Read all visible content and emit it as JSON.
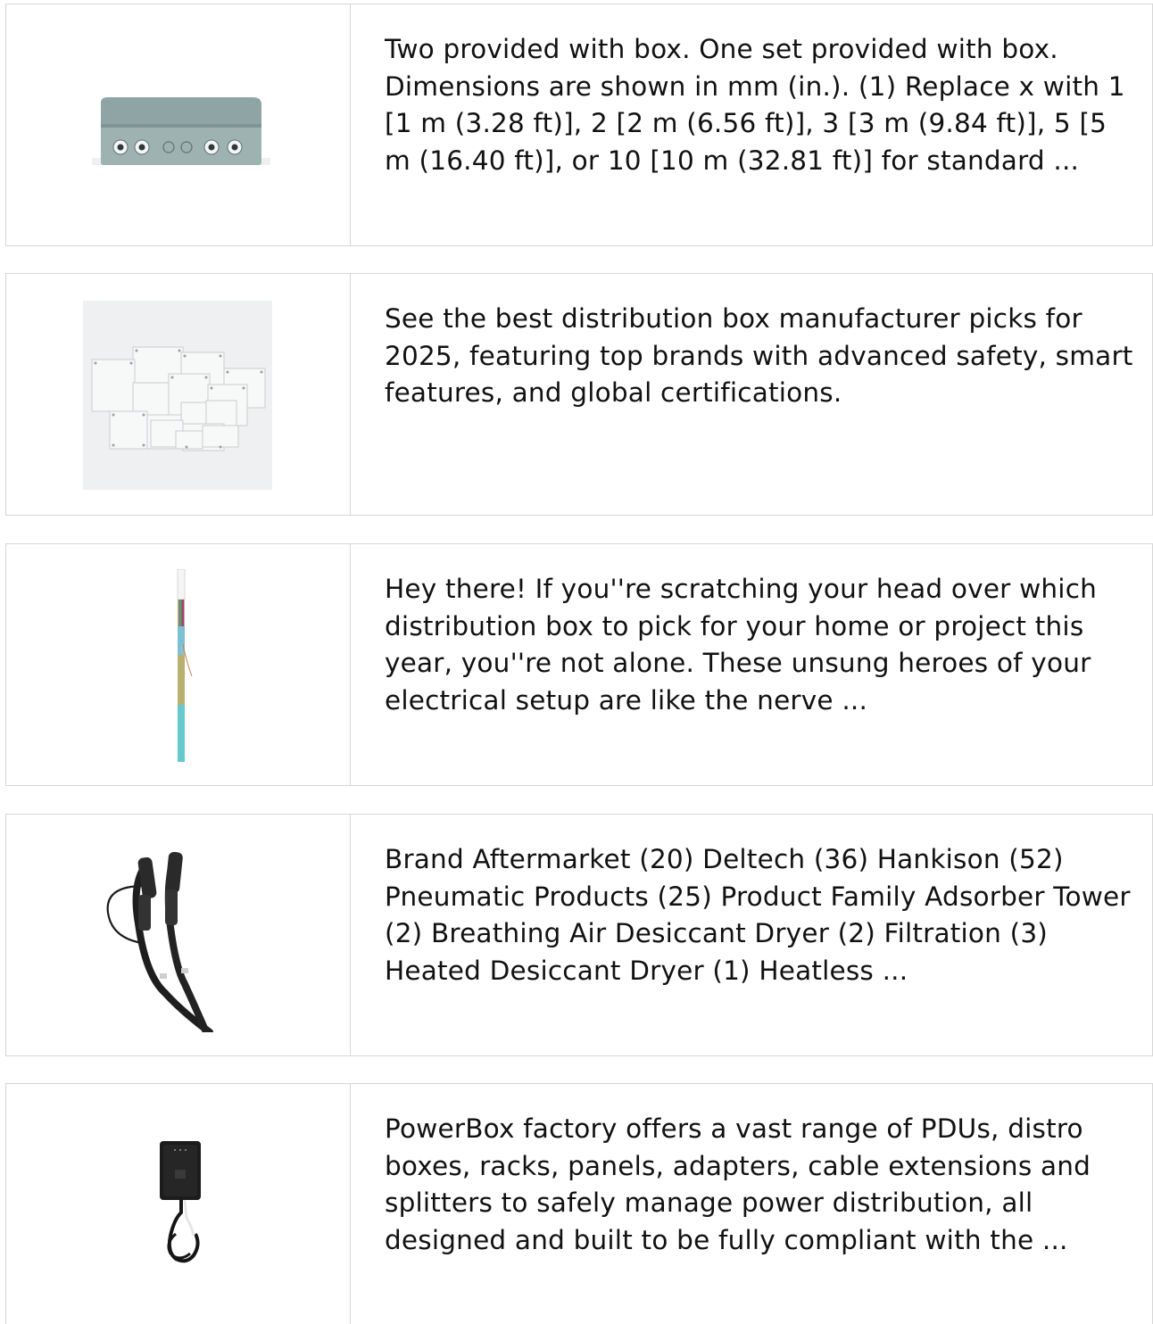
{
  "results": [
    {
      "icon": "gray-junction-box-image",
      "snippet": "Two provided with box. One set provided with box. Dimensions are shown in mm (in.). (1) Replace x with 1 [1 m (3.28 ft)], 2 [2 m (6.56 ft)], 3 [3 m (9.84 ft)], 5 [5 m (16.40 ft)], or 10 [10 m (32.81 ft)] for standard ..."
    },
    {
      "icon": "stacked-enclosures-image",
      "snippet": "See the best distribution box manufacturer picks for 2025, featuring top brands with advanced safety, smart features, and global certifications."
    },
    {
      "icon": "fiber-cable-image",
      "snippet": "Hey there! If you''re scratching your head over which distribution box to pick for your home or project this year, you''re not alone. These unsung heroes of your electrical setup are like the nerve ..."
    },
    {
      "icon": "black-connector-cables-image",
      "snippet": "Brand Aftermarket (20) Deltech (36) Hankison (52) Pneumatic Products (25) Product Family Adsorber Tower (2) Breathing Air Desiccant Dryer (2) Filtration (3) Heated Desiccant Dryer (1) Heatless ..."
    },
    {
      "icon": "wall-charger-image",
      "snippet": "PowerBox factory offers a vast range of PDUs, distro boxes, racks, panels, adapters, cable extensions and splitters to safely manage power distribution, all designed and built to be fully compliant with the ..."
    }
  ]
}
